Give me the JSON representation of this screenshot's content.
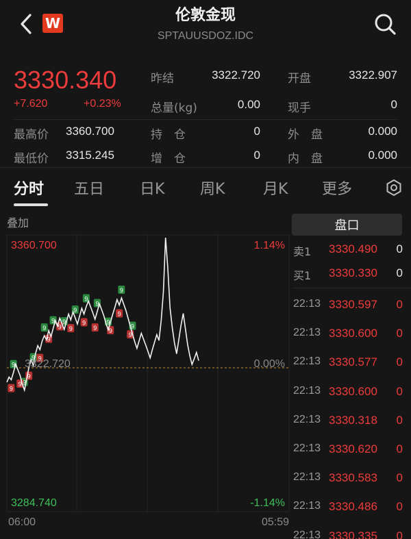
{
  "header": {
    "title": "伦敦金现",
    "subtitle": "SPTAUUSDOZ.IDC",
    "logo_letter": "W"
  },
  "quote": {
    "price": "3330.340",
    "change": "+7.620",
    "change_pct": "+0.23%",
    "prev_close_label": "昨结",
    "prev_close": "3322.720",
    "open_label": "开盘",
    "open": "3322.907",
    "volume_label": "总量(kg)",
    "volume": "0.00",
    "hand_label": "现手",
    "hand": "0",
    "high_label": "最高价",
    "high": "3360.700",
    "hold_label": "持　仓",
    "hold": "0",
    "outer_label": "外　盘",
    "outer": "0.000",
    "low_label": "最低价",
    "low": "3315.245",
    "add_label": "增　仓",
    "add": "0",
    "inner_label": "内　盘",
    "inner": "0.000"
  },
  "tabs": [
    "分时",
    "五日",
    "日K",
    "周K",
    "月K",
    "更多"
  ],
  "chart": {
    "overlay_label": "叠加",
    "top_price": "3360.700",
    "top_pct": "1.14%",
    "mid_price": "3322.720",
    "mid_pct": "0.00%",
    "bottom_price": "3284.740",
    "bottom_pct": "-1.14%",
    "start_time": "06:00",
    "end_time": "05:59"
  },
  "chart_data": {
    "type": "line",
    "y_range": [
      3284.74,
      3360.7
    ],
    "baseline": 3322.72,
    "values": [
      3318.5,
      3320.0,
      3319.2,
      3321.4,
      3323.8,
      3322.1,
      3320.5,
      3318.0,
      3316.2,
      3319.5,
      3322.8,
      3325.1,
      3323.4,
      3326.8,
      3329.2,
      3328.0,
      3330.5,
      3332.1,
      3330.9,
      3333.6,
      3331.8,
      3334.2,
      3336.5,
      3334.9,
      3337.2,
      3335.6,
      3333.9,
      3336.1,
      3338.4,
      3336.7,
      3339.0,
      3337.3,
      3335.5,
      3337.8,
      3340.1,
      3338.4,
      3340.6,
      3342.2,
      3340.5,
      3338.8,
      3336.9,
      3339.2,
      3341.4,
      3339.7,
      3337.9,
      3335.6,
      3333.8,
      3336.1,
      3338.3,
      3340.4,
      3342.6,
      3341.0,
      3343.1,
      3341.3,
      3339.5,
      3337.2,
      3334.9,
      3332.6,
      3330.3,
      3328.4,
      3330.6,
      3332.8,
      3331.1,
      3329.3,
      3327.5,
      3325.6,
      3328.0,
      3330.2,
      3332.4,
      3330.7,
      3336.5,
      3344.8,
      3360.7,
      3352.0,
      3340.3,
      3334.6,
      3330.1,
      3326.8,
      3330.9,
      3335.2,
      3338.6,
      3334.1,
      3329.5,
      3326.2,
      3323.7,
      3325.4,
      3327.2,
      3324.8
    ],
    "bubble_up": [
      3,
      8,
      12,
      17,
      21,
      26,
      31,
      36,
      41,
      46,
      52,
      57
    ],
    "bubble_down": [
      2,
      6,
      10,
      15,
      19,
      24,
      29,
      35,
      40,
      47,
      51,
      56
    ]
  },
  "orderbook": {
    "button": "盘口",
    "ask": {
      "label": "卖1",
      "price": "3330.490",
      "vol": "0"
    },
    "bid": {
      "label": "买1",
      "price": "3330.330",
      "vol": "0"
    },
    "trades": [
      {
        "time": "22:13",
        "price": "3330.597",
        "vol": "0"
      },
      {
        "time": "22:13",
        "price": "3330.600",
        "vol": "0"
      },
      {
        "time": "22:13",
        "price": "3330.577",
        "vol": "0"
      },
      {
        "time": "22:13",
        "price": "3330.600",
        "vol": "0"
      },
      {
        "time": "22:13",
        "price": "3330.318",
        "vol": "0"
      },
      {
        "time": "22:13",
        "price": "3330.620",
        "vol": "0"
      },
      {
        "time": "22:13",
        "price": "3330.583",
        "vol": "0"
      },
      {
        "time": "22:13",
        "price": "3330.486",
        "vol": "0"
      },
      {
        "time": "22:13",
        "price": "3330.335",
        "vol": "0"
      }
    ]
  }
}
